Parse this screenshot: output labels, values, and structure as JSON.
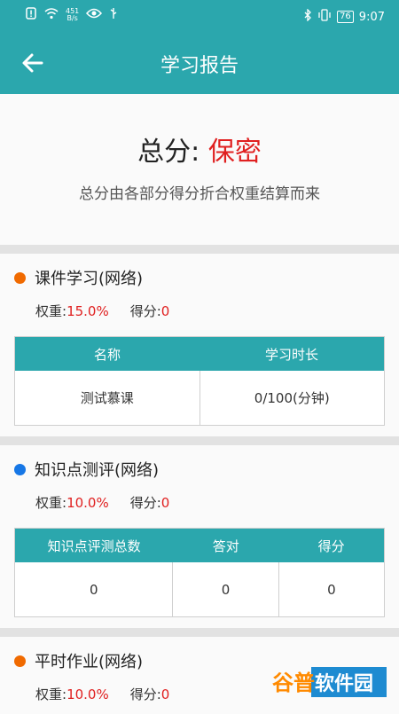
{
  "status_bar": {
    "speed_value": "451",
    "speed_unit": "B/s",
    "battery": "76",
    "time": "9:07"
  },
  "app_bar": {
    "title": "学习报告"
  },
  "summary": {
    "score_label": "总分: ",
    "score_value": "保密",
    "description": "总分由各部分得分折合权重结算而来"
  },
  "sections": [
    {
      "title": "课件学习(网络)",
      "dot_color": "#f06a00",
      "weight_label": "权重:",
      "weight_value": "15.0%",
      "score_label": "得分:",
      "score_value": "0",
      "columns": [
        "名称",
        "学习时长"
      ],
      "rows": [
        [
          "测试慕课",
          "0/100(分钟)"
        ]
      ]
    },
    {
      "title": "知识点测评(网络)",
      "dot_color": "#1677e6",
      "weight_label": "权重:",
      "weight_value": "10.0%",
      "score_label": "得分:",
      "score_value": "0",
      "columns": [
        "知识点评测总数",
        "答对",
        "得分"
      ],
      "rows": [
        [
          "0",
          "0",
          "0"
        ]
      ]
    },
    {
      "title": "平时作业(网络)",
      "dot_color": "#f06a00",
      "weight_label": "权重:",
      "weight_value": "10.0%",
      "score_label": "得分:",
      "score_value": "0"
    }
  ],
  "watermark": {
    "text": "谷普软件园"
  },
  "colors": {
    "teal": "#2ba7ad",
    "red": "#e02020"
  }
}
